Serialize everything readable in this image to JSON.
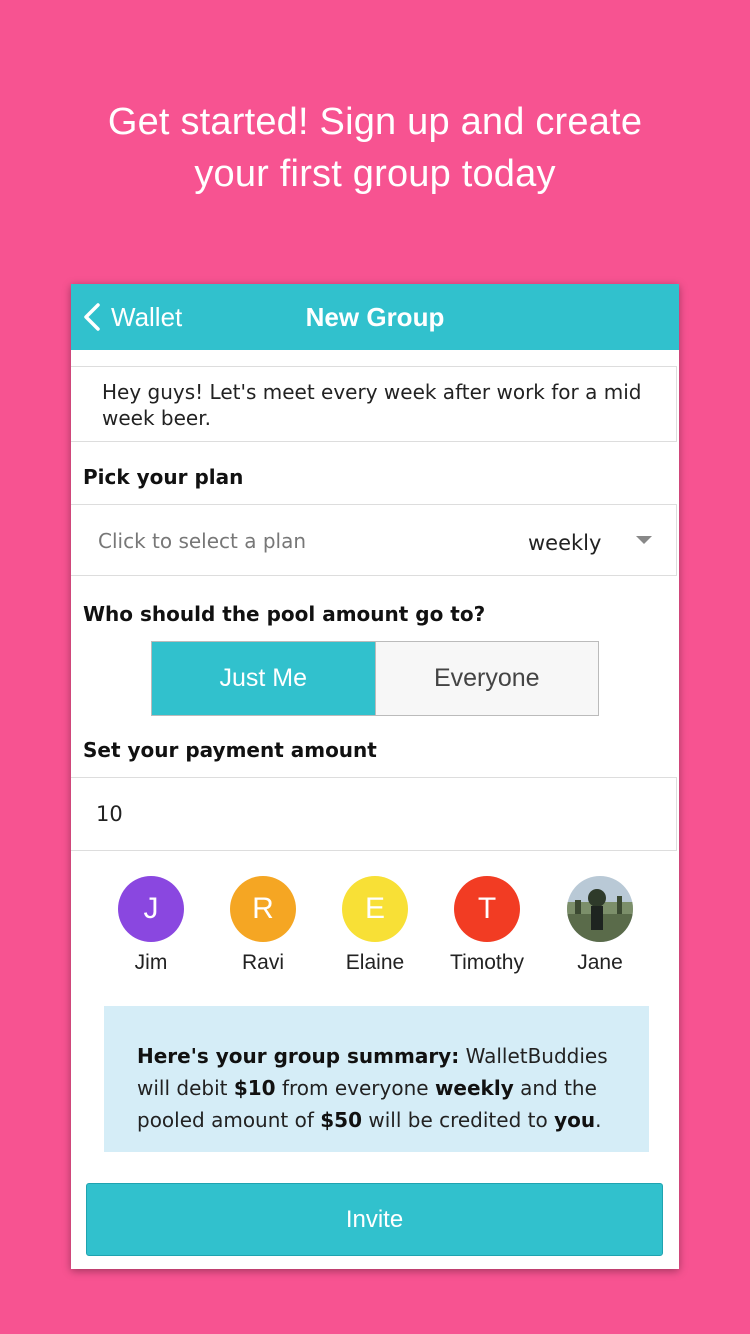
{
  "headline": {
    "line1": "Get started! Sign up and create",
    "line2": "your first group today"
  },
  "colors": {
    "background": "#f75391",
    "accent": "#31c1cd",
    "summary_bg": "#d5edf7"
  },
  "navbar": {
    "back_label": "Wallet",
    "title": "New Group"
  },
  "message": "Hey guys! Let's meet every week after work for a mid week beer.",
  "plan": {
    "label": "Pick your plan",
    "placeholder": "Click to select a plan",
    "value": "weekly"
  },
  "pool": {
    "label": "Who should the pool amount go to?",
    "options": [
      "Just Me",
      "Everyone"
    ],
    "selected": "Just Me"
  },
  "payment": {
    "label": "Set your payment amount",
    "value": "10"
  },
  "members": [
    {
      "initial": "J",
      "name": "Jim",
      "color": "#8a47e0"
    },
    {
      "initial": "R",
      "name": "Ravi",
      "color": "#f5a623"
    },
    {
      "initial": "E",
      "name": "Elaine",
      "color": "#f8e036"
    },
    {
      "initial": "T",
      "name": "Timothy",
      "color": "#f23c23"
    },
    {
      "initial": "",
      "name": "Jane",
      "color": "#6b7f8e",
      "photo": true
    }
  ],
  "summary": {
    "heading": "Here's your group summary:",
    "part1": " WalletBuddies will debit ",
    "amount": "$10",
    "part2": " from everyone ",
    "frequency": "weekly",
    "part3": " and the pooled amount of ",
    "pooled": "$50",
    "part4": " will be credited to ",
    "recipient": "you",
    "part5": "."
  },
  "invite_label": "Invite"
}
